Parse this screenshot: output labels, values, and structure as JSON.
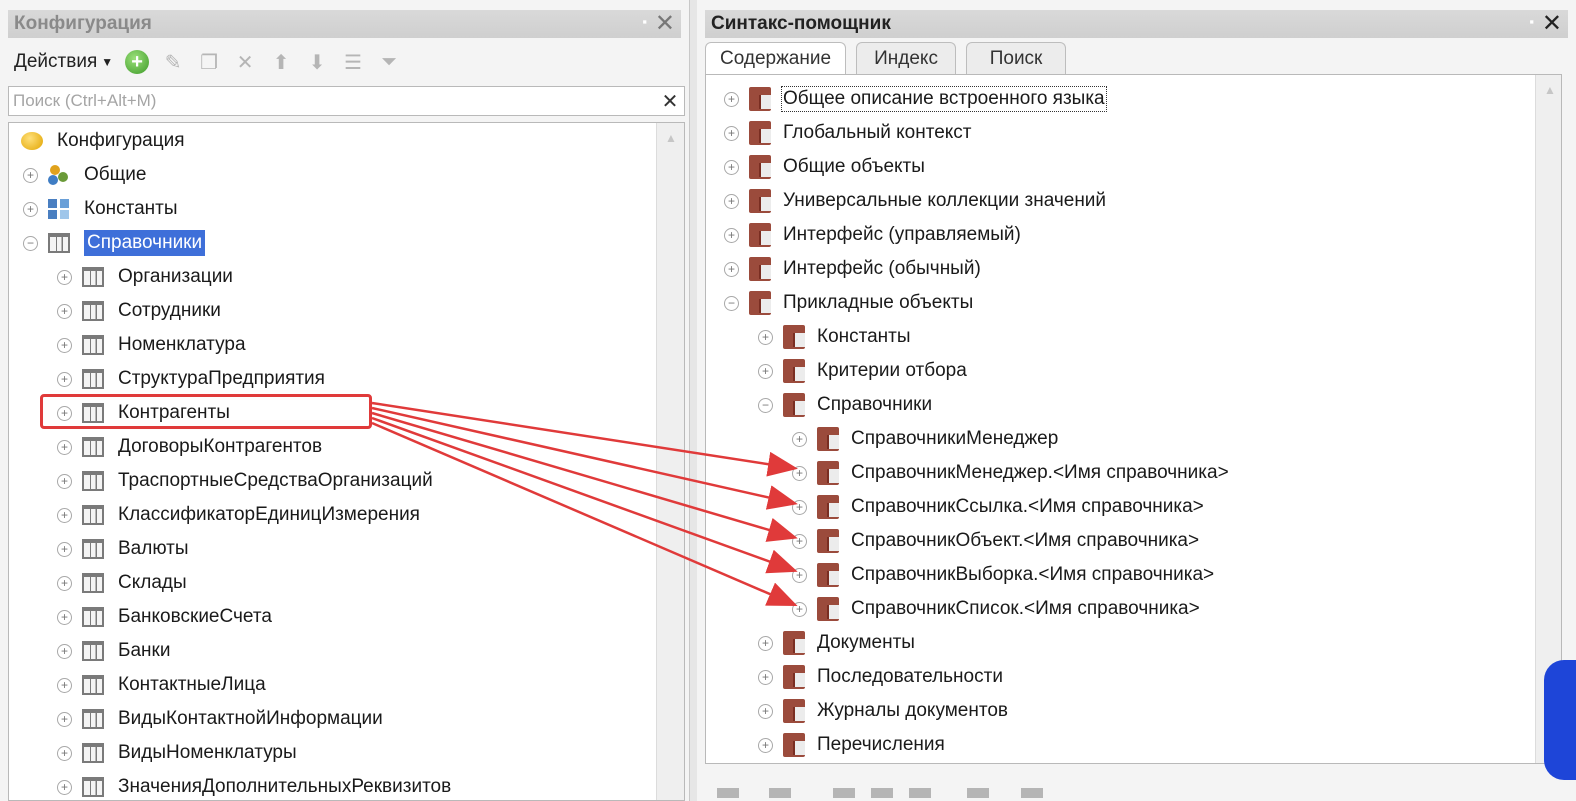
{
  "left_panel": {
    "title": "Конфигурация",
    "toolbar": {
      "actions_label": "Действия"
    },
    "search": {
      "placeholder": "Поиск (Ctrl+Alt+M)"
    },
    "tree": {
      "root": "Конфигурация",
      "common": "Общие",
      "constants": "Константы",
      "catalogs": "Справочники",
      "children": [
        "Организации",
        "Сотрудники",
        "Номенклатура",
        "СтруктураПредприятия",
        "Контрагенты",
        "ДоговорыКонтрагентов",
        "ТраспортныеСредстваОрганизаций",
        "КлассификаторЕдиницИзмерения",
        "Валюты",
        "Склады",
        "БанковскиеСчета",
        "Банки",
        "КонтактныеЛица",
        "ВидыКонтактнойИнформации",
        "ВидыНоменклатуры",
        "ЗначенияДополнительныхРеквизитов"
      ]
    }
  },
  "right_panel": {
    "title": "Синтакс-помощник",
    "tabs": [
      "Содержание",
      "Индекс",
      "Поиск"
    ],
    "tree": {
      "top": [
        "Общее описание встроенного языка",
        "Глобальный контекст",
        "Общие объекты",
        "Универсальные коллекции значений",
        "Интерфейс (управляемый)",
        "Интерфейс (обычный)",
        "Прикладные объекты"
      ],
      "applied": {
        "constants": "Константы",
        "selection_criteria": "Критерии отбора",
        "catalogs": "Справочники"
      },
      "catalog_children": [
        "СправочникиМенеджер",
        "СправочникМенеджер.<Имя справочника>",
        "СправочникСсылка.<Имя справочника>",
        "СправочникОбъект.<Имя справочника>",
        "СправочникВыборка.<Имя справочника>",
        "СправочникСписок.<Имя справочника>"
      ],
      "after": [
        "Документы",
        "Последовательности",
        "Журналы документов",
        "Перечисления"
      ]
    }
  },
  "colors": {
    "selection": "#3e6fd9",
    "annotation_red": "#e03a3a",
    "accent_blue": "#1e45d8"
  }
}
